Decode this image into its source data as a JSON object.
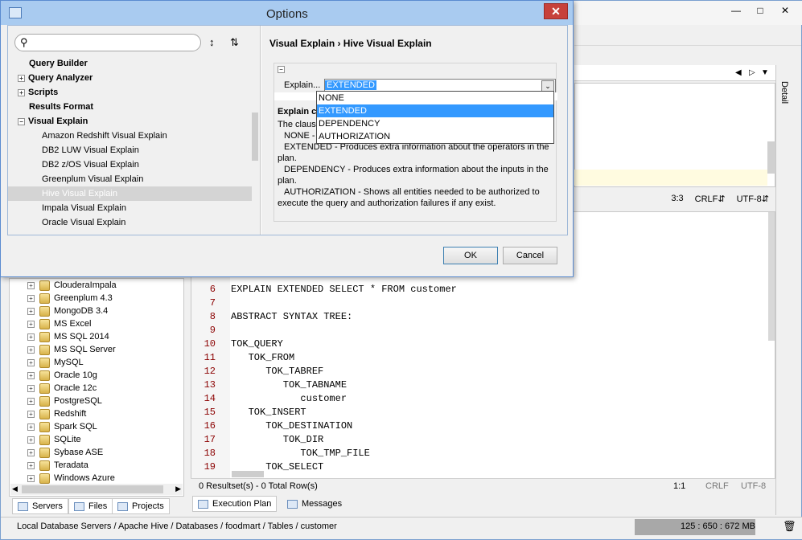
{
  "dialog": {
    "title": "Options",
    "breadcrumb": "Visual Explain › Hive Visual Explain",
    "tree_items": [
      {
        "label": "Query Builder",
        "bold": true,
        "expander": false,
        "indent": 0
      },
      {
        "label": "Query Analyzer",
        "bold": true,
        "expander": true,
        "indent": 0
      },
      {
        "label": "Scripts",
        "bold": true,
        "expander": true,
        "indent": 0
      },
      {
        "label": "Results Format",
        "bold": true,
        "expander": false,
        "indent": 0
      },
      {
        "label": "Visual Explain",
        "bold": true,
        "expander": true,
        "indent": 0
      },
      {
        "label": "Amazon Redshift Visual Explain",
        "bold": false,
        "expander": false,
        "indent": 1
      },
      {
        "label": "DB2 LUW Visual Explain",
        "bold": false,
        "expander": false,
        "indent": 1
      },
      {
        "label": "DB2 z/OS Visual Explain",
        "bold": false,
        "expander": false,
        "indent": 1
      },
      {
        "label": "Greenplum Visual Explain",
        "bold": false,
        "expander": false,
        "indent": 1
      },
      {
        "label": "Hive Visual Explain",
        "bold": false,
        "expander": false,
        "indent": 1,
        "selected": true
      },
      {
        "label": "Impala Visual Explain",
        "bold": false,
        "expander": false,
        "indent": 1
      },
      {
        "label": "Oracle Visual Explain",
        "bold": false,
        "expander": false,
        "indent": 1
      }
    ],
    "explain_label": "Explain...",
    "explain_value": "EXTENDED",
    "explain_options": [
      "NONE",
      "EXTENDED",
      "DEPENDENCY",
      "AUTHORIZATION"
    ],
    "explain_selected_index": 1,
    "desc_title": "Explain clau",
    "desc_intro": "The clause us",
    "desc_none": "NONE - Bas",
    "desc_lines": [
      "EXTENDED - Produces extra information about the operators in the",
      "plan.",
      "DEPENDENCY - Produces extra information about the inputs in the",
      "plan.",
      "AUTHORIZATION - Shows all entities needed to be authorized to",
      "execute the query and authorization failures if any exist."
    ],
    "ok_label": "OK",
    "cancel_label": "Cancel"
  },
  "server_tree": [
    "ClouderaImpala",
    "Greenplum 4.3",
    "MongoDB 3.4",
    "MS Excel",
    "MS SQL 2014",
    "MS SQL Server",
    "MySQL",
    "Oracle 10g",
    "Oracle 12c",
    "PostgreSQL",
    "Redshift",
    "Spark SQL",
    "SQLite",
    "Sybase ASE",
    "Teradata",
    "Windows Azure"
  ],
  "left_tabs": [
    "Servers",
    "Files",
    "Projects"
  ],
  "editor": {
    "lines": [
      {
        "n": "6",
        "text": "EXPLAIN EXTENDED SELECT * FROM customer"
      },
      {
        "n": "7",
        "text": ""
      },
      {
        "n": "8",
        "text": "ABSTRACT SYNTAX TREE:"
      },
      {
        "n": "9",
        "text": ""
      },
      {
        "n": "10",
        "text": "TOK_QUERY"
      },
      {
        "n": "11",
        "text": "   TOK_FROM"
      },
      {
        "n": "12",
        "text": "      TOK_TABREF"
      },
      {
        "n": "13",
        "text": "         TOK_TABNAME"
      },
      {
        "n": "14",
        "text": "            customer"
      },
      {
        "n": "15",
        "text": "   TOK_INSERT"
      },
      {
        "n": "16",
        "text": "      TOK_DESTINATION"
      },
      {
        "n": "17",
        "text": "         TOK_DIR"
      },
      {
        "n": "18",
        "text": "            TOK_TMP_FILE"
      },
      {
        "n": "19",
        "text": "      TOK_SELECT"
      }
    ],
    "status_left": "0 Resultset(s) - 0 Total Row(s)",
    "status_pos": "1:1",
    "status_eol": "CRLF",
    "status_enc": "UTF-8",
    "tabs": [
      "Execution Plan",
      "Messages"
    ]
  },
  "right_top": {
    "pos": "3:3",
    "eol": "CRLF",
    "enc": "UTF-8",
    "detail_label": "Detail"
  },
  "status_bar": {
    "path": "Local Database Servers / Apache Hive / Databases / foodmart / Tables / customer",
    "memory": "125 : 650 : 672 MB"
  },
  "colors": {
    "dialog_title_bg": "#a9cbf0",
    "selection": "#3399ff",
    "line_number": "#8b0000"
  }
}
